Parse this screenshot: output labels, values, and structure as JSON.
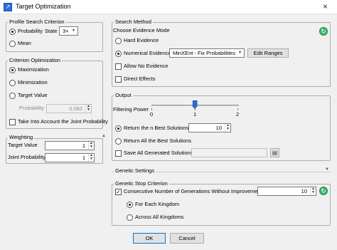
{
  "window": {
    "title": "Target Optimization",
    "close_glyph": "×"
  },
  "profile": {
    "title": "Profile Search Criterion",
    "probability_label": "Probability",
    "state_label": "State",
    "state_value": "3+",
    "mean_label": "Mean"
  },
  "criterion": {
    "title": "Criterion Optimization",
    "maximization": "Maximization",
    "minimization": "Minimization",
    "target_value": "Target Value",
    "probability_label": "Probability",
    "probability_value": "0.082",
    "joint_label": "Take Into Account the Joint Probability"
  },
  "weighting": {
    "title": "Weighting",
    "target_value_label": "Target Value",
    "target_value": "1",
    "joint_probability_label": "Joint Probability",
    "joint_probability_value": "1"
  },
  "search": {
    "title": "Search Method",
    "choose_label": "Choose Evidence Mode",
    "hard_evidence": "Hard Evidence",
    "numerical_evidence": "Numerical Evidence",
    "numerical_mode": "MinXEnt - Fix Probabilities",
    "edit_ranges": "Edit Ranges",
    "allow_no_evidence": "Allow No Evidence",
    "direct_effects": "Direct Effects"
  },
  "output": {
    "title": "Output",
    "filtering_power_label": "Filtering Power",
    "slider_min": "0",
    "slider_mid": "1",
    "slider_max": "2",
    "filtering_power_value": 1,
    "return_n_best": "Return the n Best Solutions",
    "n_best_value": "10",
    "return_all_best": "Return All the Best Solutions",
    "save_all": "Save All Generated Solutions",
    "save_path": ""
  },
  "genetic_settings": {
    "title": "Genetic Settings"
  },
  "genetic_stop": {
    "title": "Genetic Stop Criterion",
    "consecutive_label": "Consecutive Number of Generations Without Improvement",
    "consecutive_value": "10",
    "for_each_kingdom": "For Each Kingdom",
    "across_all_kingdoms": "Across All Kingdoms"
  },
  "footer": {
    "ok": "OK",
    "cancel": "Cancel"
  },
  "icons": {
    "refresh": "↻",
    "spin_up": "▲",
    "spin_down": "▼",
    "dropdown": "▾",
    "collapse": "▲",
    "expand": "▼",
    "browse": "▤",
    "check": "✓"
  }
}
